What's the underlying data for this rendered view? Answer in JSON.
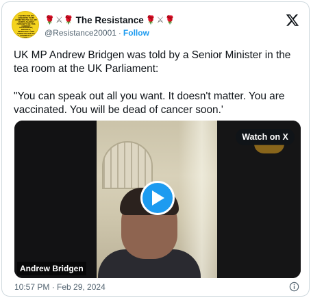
{
  "author": {
    "display_name": "The Resistance",
    "handle": "@Resistance20001",
    "separator": "·",
    "follow_label": "Follow",
    "avatar_text": "I VOTED FOR MY CONGRESS TO BE ARRESTED FOR ALL MY CRIMES AGAINST HUMANITY ON THIS CORRUPT GOVERNMENT, REPUBLIC, DEMOCRACY AND CONSTITUTION DO NOT CONSENT TO THIS GOVERNMENT. I WILL NOT COMPLY",
    "name_emoji_before": [
      "rose",
      "crossed-swords",
      "rose"
    ],
    "name_emoji_after": [
      "rose",
      "crossed-swords",
      "rose"
    ]
  },
  "tweet": {
    "paragraph_1": "UK MP Andrew Bridgen was told by a Senior Minister in the tea room at the UK Parliament:",
    "paragraph_2": "\"You can speak out all you want. It doesn't matter. You are vaccinated. You will be dead of cancer soon.'"
  },
  "media": {
    "watch_label": "Watch on X",
    "caption": "Andrew Bridgen",
    "play_icon": "play-icon"
  },
  "footer": {
    "timestamp": "10:57 PM · Feb 29, 2024",
    "info_icon": "info-icon"
  },
  "colors": {
    "accent": "#1d9bf0",
    "text_primary": "#0f1419",
    "text_secondary": "#536471",
    "border": "#cfd9de",
    "avatar_bg": "#f4d31f"
  }
}
